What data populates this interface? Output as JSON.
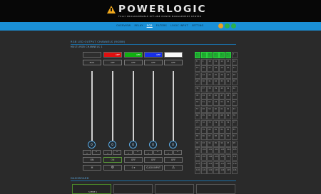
{
  "header": {
    "logo_text": "POWERLOGIC",
    "logo_subtitle": "FULLY PROGRAMMABLE OFFLINE POWER MANAGEMENT CENTER"
  },
  "nav": {
    "items": [
      "OVERVIEW",
      "RELAY",
      "RGB",
      "FILTERS",
      "LOGIC INPUT",
      "SETTING"
    ],
    "active": "RGB",
    "icons": [
      {
        "name": "settings-icon",
        "color": "#f0a020"
      },
      {
        "name": "power-icon",
        "color": "#2bb04a"
      },
      {
        "name": "refresh-icon",
        "color": "#2bb04a"
      }
    ]
  },
  "rgb_section": {
    "title": "RGB LED OUTPUT CHANNELS (RGBW)",
    "subtitle": "MULTI-RGB CHANNELS 1"
  },
  "channels": [
    {
      "swatch_color": "#2e2e2e",
      "swatch_label": "",
      "mode_label": "MAX",
      "fader": "0"
    },
    {
      "swatch_color": "#e01010",
      "swatch_label": "OFF",
      "mode_label": "OFF",
      "fader": "0"
    },
    {
      "swatch_color": "#10b010",
      "swatch_label": "OFF",
      "mode_label": "OFF",
      "fader": "0"
    },
    {
      "swatch_color": "#1830e8",
      "swatch_label": "OFF",
      "mode_label": "OFF",
      "fader": "0"
    },
    {
      "swatch_color": "#f8f8f8",
      "swatch_label": "",
      "mode_label": "OFF",
      "fader": "0"
    }
  ],
  "controls": {
    "row1": [
      "ON",
      "ON",
      "OFF",
      "OFF",
      "OFF"
    ],
    "row2": [
      "M",
      "",
      "0",
      "CLICK INPUT",
      ""
    ],
    "row2_icons": [
      "",
      "settings-icon",
      "",
      "",
      "warning-icon"
    ]
  },
  "grid": {
    "cells": [
      "1",
      "2",
      "3",
      "4",
      "5",
      "6",
      "7",
      "8",
      "9",
      "10",
      "11",
      "12",
      "13",
      "14",
      "15",
      "16",
      "17",
      "18",
      "19",
      "20",
      "21",
      "22",
      "23",
      "24",
      "25",
      "26",
      "27",
      "28",
      "29",
      "30",
      "31",
      "32",
      "33",
      "34",
      "35",
      "36",
      "37",
      "38",
      "39",
      "40",
      "41",
      "42",
      "43",
      "44",
      "45",
      "46",
      "47",
      "48",
      "49",
      "50",
      "51",
      "52",
      "53",
      "54",
      "55",
      "56",
      "57",
      "58",
      "59",
      "60",
      "61",
      "62",
      "63",
      "64",
      "65",
      "66",
      "67",
      "68",
      "69",
      "70",
      "71",
      "72",
      "73",
      "74",
      "75",
      "76",
      "77",
      "78",
      "79",
      "80",
      "81",
      "82",
      "83",
      "84",
      "85",
      "86",
      "87",
      "88",
      "89",
      "90",
      "91",
      "92",
      "93",
      "94",
      "95",
      "96",
      "97",
      "98",
      "99",
      "100",
      "101",
      "102",
      "103",
      "104",
      "105",
      "106",
      "107",
      "108",
      "109",
      "110",
      "111",
      "112",
      "113",
      "114",
      "115",
      "116",
      "117",
      "118",
      "119",
      "120",
      "121",
      "122",
      "123",
      "124",
      "125",
      "126"
    ],
    "on_count": 6
  },
  "dash_section": {
    "title": "DASHBOARD",
    "cards": [
      {
        "label": "SCENE 1",
        "active": true
      },
      {
        "label": "",
        "active": false
      },
      {
        "label": "",
        "active": false
      },
      {
        "label": "",
        "active": false
      }
    ]
  }
}
